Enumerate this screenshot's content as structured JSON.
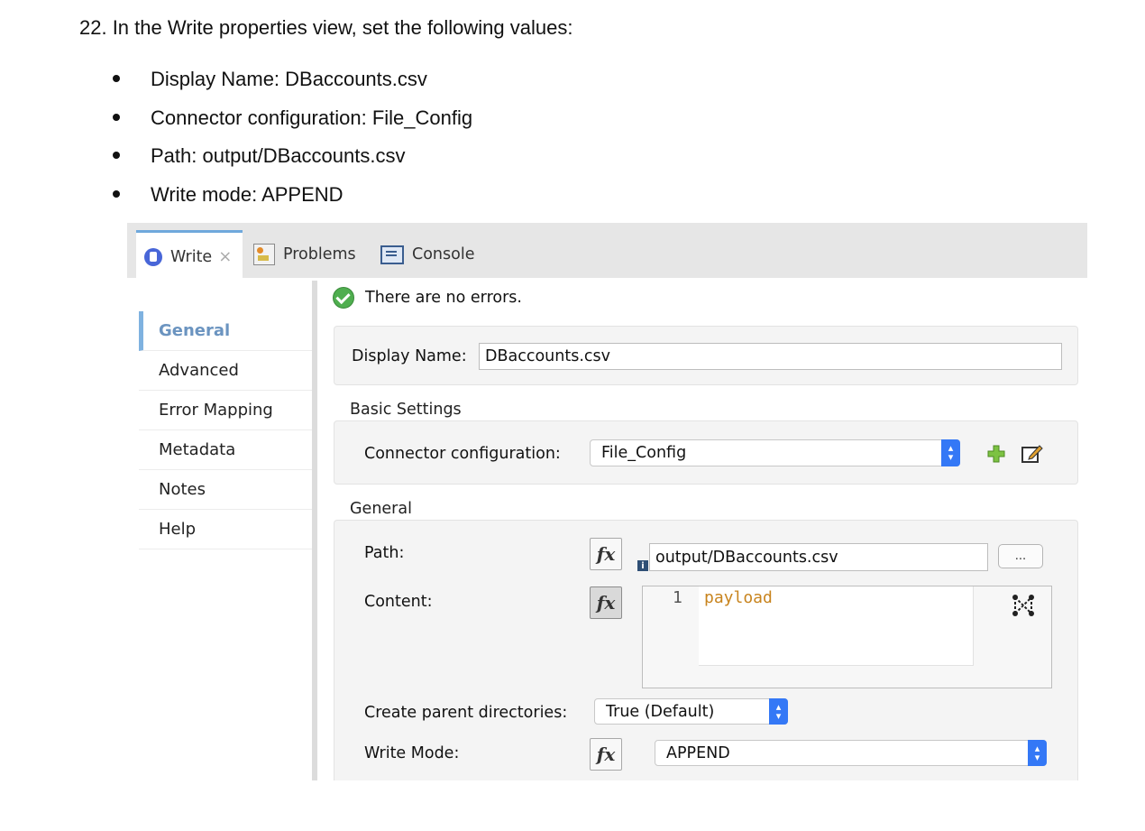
{
  "heading": "22. In the Write properties view, set the following values:",
  "bullets": [
    "Display Name: DBaccounts.csv",
    "Connector configuration: File_Config",
    "Path: output/DBaccounts.csv",
    "Write mode: APPEND"
  ],
  "tabs": {
    "write": "Write",
    "close": "×",
    "problems": "Problems",
    "console": "Console"
  },
  "sidebar": {
    "items": [
      "General",
      "Advanced",
      "Error Mapping",
      "Metadata",
      "Notes",
      "Help"
    ]
  },
  "status": "There are no errors.",
  "form": {
    "display_name_label": "Display Name:",
    "display_name_value": "DBaccounts.csv",
    "basic_settings_title": "Basic Settings",
    "connector_label": "Connector configuration:",
    "connector_value": "File_Config",
    "general_title": "General",
    "path_label": "Path:",
    "path_value": "output/DBaccounts.csv",
    "path_button": "...",
    "content_label": "Content:",
    "content_line_number": "1",
    "content_code": "payload",
    "create_parent_label": "Create parent directories:",
    "create_parent_value": "True (Default)",
    "write_mode_label": "Write Mode:",
    "write_mode_value": "APPEND",
    "fx": "fx",
    "info": "i"
  },
  "colors": {
    "accent_blue": "#3478f6",
    "active_tab_border": "#6fa8dc",
    "code_keyword": "#c8841e",
    "ok_green": "#4fae4f"
  }
}
